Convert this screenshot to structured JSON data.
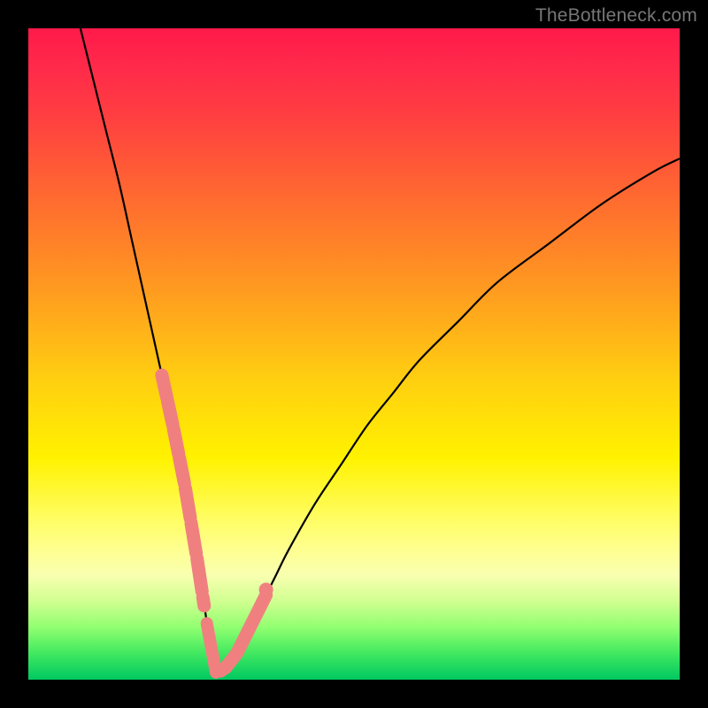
{
  "watermark": "TheBottleneck.com",
  "chart_data": {
    "type": "line",
    "title": "",
    "xlabel": "",
    "ylabel": "",
    "xlim": [
      0,
      100
    ],
    "ylim": [
      0,
      100
    ],
    "minimum_x": 28,
    "series": [
      {
        "name": "curve",
        "x": [
          8,
          10,
          12,
          14,
          16,
          18,
          20,
          22,
          24,
          26,
          27.5,
          28,
          28.5,
          30,
          32,
          34,
          36,
          38,
          40,
          44,
          48,
          52,
          56,
          60,
          66,
          72,
          80,
          88,
          96,
          100
        ],
        "y": [
          100,
          92,
          84,
          76,
          67,
          58,
          49,
          40,
          30,
          18,
          8,
          2,
          1,
          1.5,
          4,
          8,
          12,
          16,
          20,
          27,
          33,
          39,
          44,
          49,
          55,
          61,
          67,
          73,
          78,
          80
        ]
      }
    ],
    "highlighted_ranges": [
      {
        "x_start": 20.5,
        "x_end": 27.0,
        "branch": "left"
      },
      {
        "x_start": 29.5,
        "x_end": 36.5,
        "branch": "right"
      }
    ],
    "gradient_stops": [
      {
        "pos": 0.0,
        "color": "#ff1a4a"
      },
      {
        "pos": 0.4,
        "color": "#ff9a20"
      },
      {
        "pos": 0.66,
        "color": "#fff200"
      },
      {
        "pos": 0.88,
        "color": "#d0ff90"
      },
      {
        "pos": 1.0,
        "color": "#00c860"
      }
    ]
  }
}
